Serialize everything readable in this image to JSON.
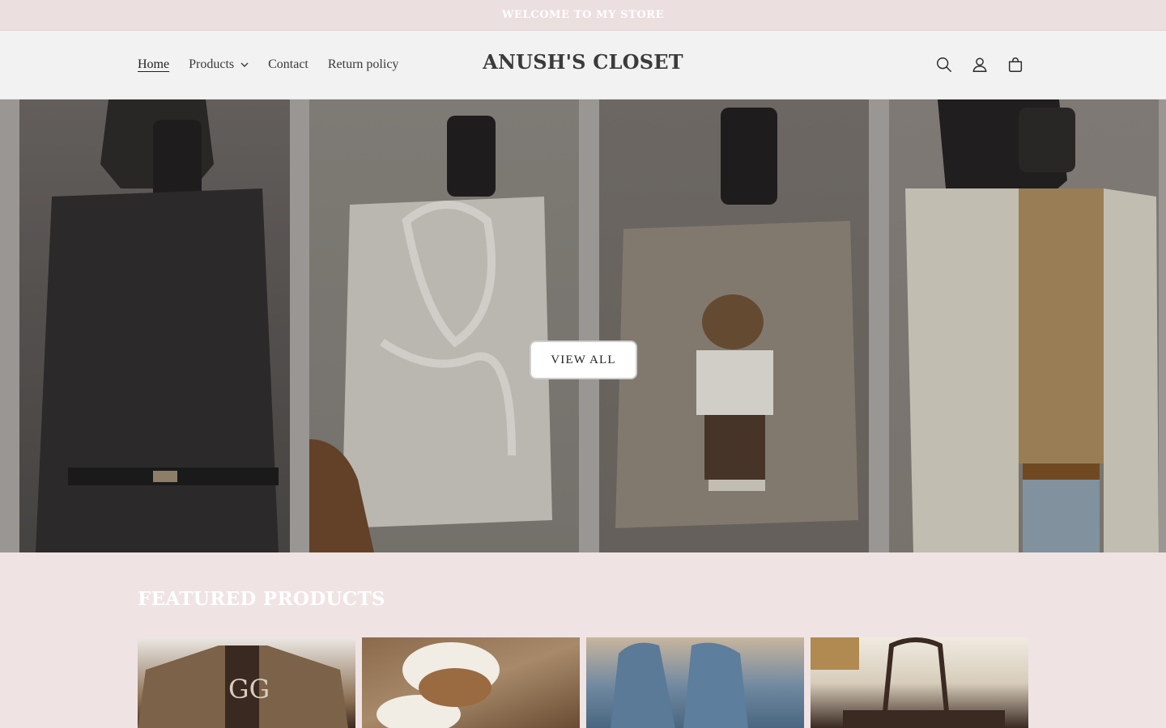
{
  "announcement": {
    "text": "WELCOME TO MY STORE"
  },
  "header": {
    "logo": "ANUSH'S CLOSET",
    "nav": [
      {
        "label": "Home",
        "active": true
      },
      {
        "label": "Products",
        "has_dropdown": true
      },
      {
        "label": "Contact"
      },
      {
        "label": "Return policy"
      }
    ],
    "icons": [
      "search-icon",
      "account-icon",
      "cart-icon"
    ]
  },
  "hero": {
    "button_label": "VIEW ALL",
    "images": [
      "black-sweater-outfit",
      "white-knit-vest-outfit",
      "bear-sweater-outfit",
      "cream-cardigan-outfit"
    ]
  },
  "featured": {
    "title": "FEATURED PRODUCTS",
    "products": [
      "brown-cardigan",
      "shearling-slippers",
      "blue-loafers",
      "brown-handbag"
    ]
  },
  "colors": {
    "page_background": "#efe3e4",
    "header_background": "#f2f2f2",
    "text": "#2b2b2b"
  }
}
